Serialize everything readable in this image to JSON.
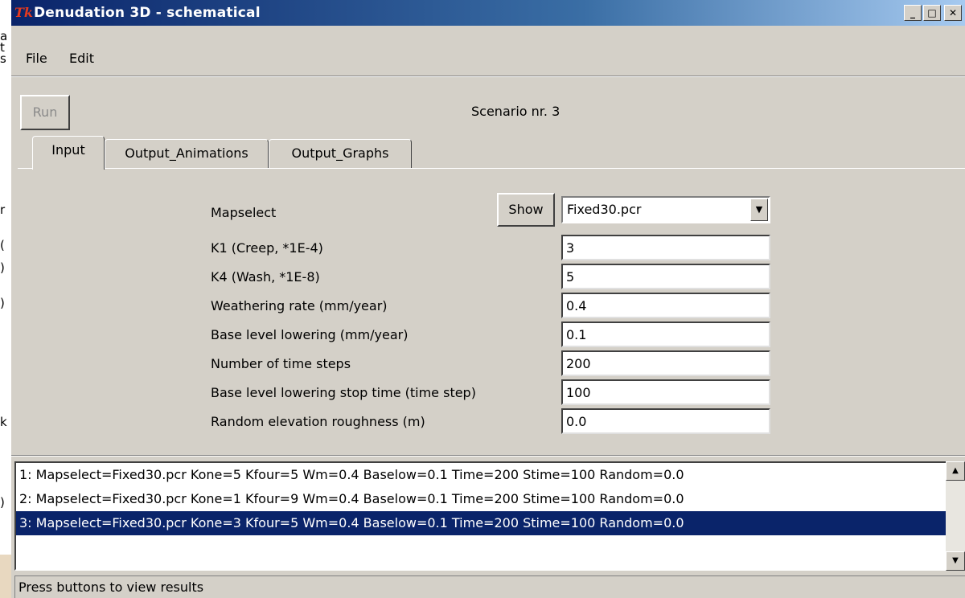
{
  "background_window": {
    "fragments": [
      "a",
      "t",
      "s",
      "r",
      "(",
      ")",
      ")",
      "k",
      ")"
    ]
  },
  "window": {
    "title": "Denudation 3D - schematical",
    "app_icon": "Tk",
    "controls": {
      "minimize": "_",
      "maximize": "□",
      "close": "✕"
    }
  },
  "menu": {
    "items": [
      "File",
      "Edit"
    ]
  },
  "toolbar": {
    "run_label": "Run",
    "scenario_text": "Scenario nr. 3"
  },
  "tabs": [
    {
      "label": "Input",
      "active": true
    },
    {
      "label": "Output_Animations",
      "active": false
    },
    {
      "label": "Output_Graphs",
      "active": false
    }
  ],
  "input_panel": {
    "mapselect": {
      "label": "Mapselect",
      "show_label": "Show",
      "value": "Fixed30.pcr"
    },
    "params": [
      {
        "label": "K1 (Creep, *1E-4)",
        "value": "3"
      },
      {
        "label": "K4 (Wash, *1E-8)",
        "value": "5"
      },
      {
        "label": "Weathering rate (mm/year)",
        "value": "0.4"
      },
      {
        "label": "Base level lowering (mm/year)",
        "value": "0.1"
      },
      {
        "label": "Number of time steps",
        "value": "200"
      },
      {
        "label": "Base level lowering stop time (time step)",
        "value": "100"
      },
      {
        "label": "Random elevation roughness (m)",
        "value": "0.0"
      }
    ]
  },
  "scenarios": [
    {
      "text": "1: Mapselect=Fixed30.pcr Kone=5 Kfour=5 Wm=0.4 Baselow=0.1 Time=200 Stime=100 Random=0.0",
      "selected": false
    },
    {
      "text": "2: Mapselect=Fixed30.pcr Kone=1 Kfour=9 Wm=0.4 Baselow=0.1 Time=200 Stime=100 Random=0.0",
      "selected": false
    },
    {
      "text": "3: Mapselect=Fixed30.pcr Kone=3 Kfour=5 Wm=0.4 Baselow=0.1 Time=200 Stime=100 Random=0.0",
      "selected": true
    }
  ],
  "scrollbar": {
    "up": "▲",
    "down": "▼"
  },
  "combo_arrow": "▼",
  "status": {
    "text": "Press buttons to view results"
  },
  "colors": {
    "titlebar_start": "#0a246a",
    "titlebar_end": "#a6caf0",
    "selection": "#0a246a",
    "face": "#d4d0c8",
    "icon": "#e63a1e"
  }
}
